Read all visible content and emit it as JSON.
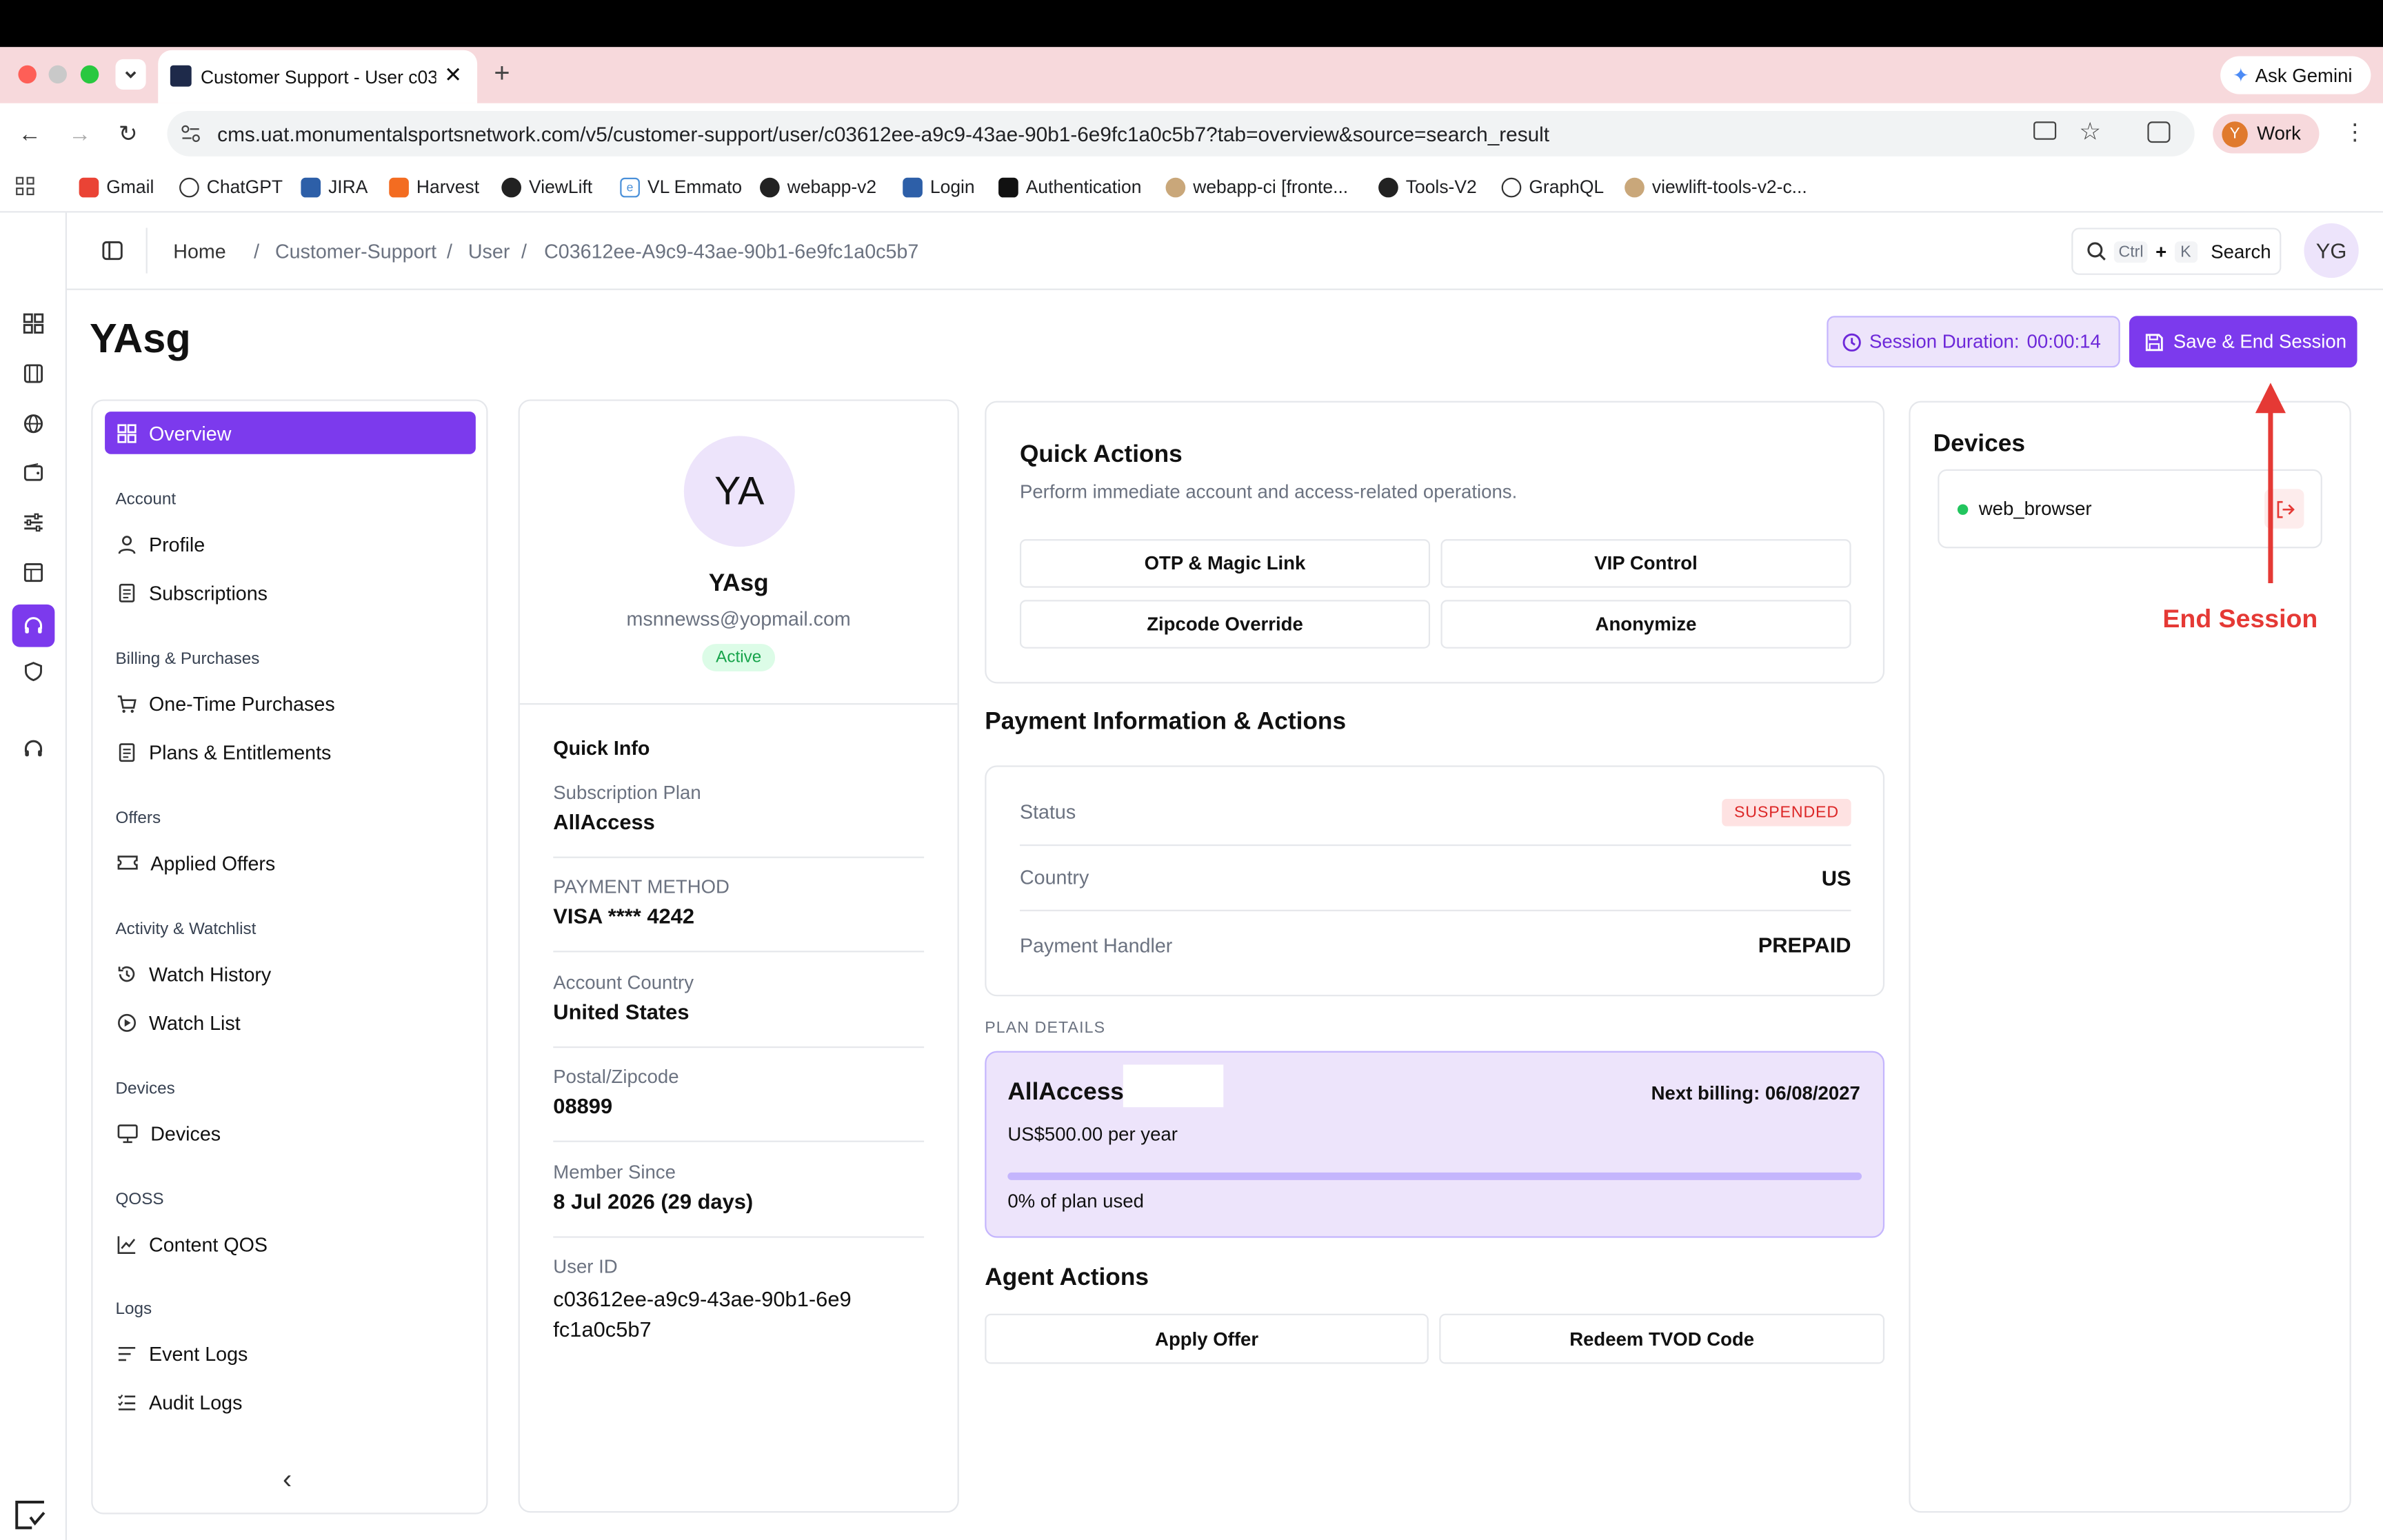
{
  "browser": {
    "tab_title": "Customer Support - User c03",
    "url": "cms.uat.monumentalsportsnetwork.com/v5/customer-support/user/c03612ee-a9c9-43ae-90b1-6e9fc1a0c5b7?tab=overview&source=search_result",
    "ask_gemini": "Ask Gemini",
    "profile_label": "Work",
    "profile_initial": "Y",
    "bookmarks": [
      "Gmail",
      "ChatGPT",
      "JIRA",
      "Harvest",
      "ViewLift",
      "VL Emmato",
      "webapp-v2",
      "Login",
      "Authentication",
      "webapp-ci [fronte...",
      "Tools-V2",
      "GraphQL",
      "viewlift-tools-v2-c..."
    ]
  },
  "header": {
    "breadcrumb": [
      "Home",
      "Customer-Support",
      "User",
      "C03612ee-A9c9-43ae-90b1-6e9fc1a0c5b7"
    ],
    "search_key1": "Ctrl",
    "search_plus": "+",
    "search_key2": "K",
    "search_label": "Search",
    "avatar": "YG"
  },
  "page": {
    "title": "YAsg",
    "session_label": "Session Duration:",
    "session_time": "00:00:14",
    "save_end": "Save & End Session"
  },
  "sidebar": {
    "overview": "Overview",
    "groups": [
      {
        "title": "Account",
        "items": [
          "Profile",
          "Subscriptions"
        ]
      },
      {
        "title": "Billing & Purchases",
        "items": [
          "One-Time Purchases",
          "Plans & Entitlements"
        ]
      },
      {
        "title": "Offers",
        "items": [
          "Applied Offers"
        ]
      },
      {
        "title": "Activity & Watchlist",
        "items": [
          "Watch History",
          "Watch List"
        ]
      },
      {
        "title": "Devices",
        "items": [
          "Devices"
        ]
      },
      {
        "title": "QOSS",
        "items": [
          "Content QOS"
        ]
      },
      {
        "title": "Logs",
        "items": [
          "Event Logs",
          "Audit Logs"
        ]
      }
    ],
    "collapse": "‹"
  },
  "profile": {
    "initials": "YA",
    "name": "YAsg",
    "email": "msnnewss@yopmail.com",
    "status": "Active",
    "quick_info_title": "Quick Info",
    "info": [
      {
        "label": "Subscription Plan",
        "value": "AllAccess"
      },
      {
        "label": "PAYMENT METHOD",
        "value": "VISA **** 4242"
      },
      {
        "label": "Account Country",
        "value": "United States"
      },
      {
        "label": "Postal/Zipcode",
        "value": "08899"
      },
      {
        "label": "Member Since",
        "value": "8 Jul 2026 (29 days)"
      },
      {
        "label": "User ID",
        "value": "c03612ee-a9c9-43ae-90b1-6e9fc1a0c5b7"
      }
    ]
  },
  "quick_actions": {
    "title": "Quick Actions",
    "subtitle": "Perform immediate account and access-related operations.",
    "buttons": [
      "OTP & Magic Link",
      "VIP Control",
      "Zipcode Override",
      "Anonymize"
    ]
  },
  "payment": {
    "title": "Payment Information & Actions",
    "rows": [
      {
        "label": "Status",
        "value": "SUSPENDED"
      },
      {
        "label": "Country",
        "value": "US"
      },
      {
        "label": "Payment Handler",
        "value": "PREPAID"
      }
    ],
    "plan_details_label": "PLAN DETAILS",
    "plan_name": "AllAccess",
    "next_billing": "Next billing: 06/08/2027",
    "price": "US$500.00 per year",
    "usage_text": "0% of plan used",
    "usage_fraction": 0
  },
  "agent_actions": {
    "title": "Agent Actions",
    "buttons": [
      "Apply Offer",
      "Redeem TVOD Code"
    ]
  },
  "devices": {
    "title": "Devices",
    "items": [
      "web_browser"
    ]
  },
  "annotation": {
    "label": "End Session",
    "color": "#e53935"
  },
  "colors": {
    "accent": "#7c3aed",
    "accent_light": "#ede4fb",
    "active_green": "#16a34a",
    "suspended_red": "#dc2626"
  }
}
